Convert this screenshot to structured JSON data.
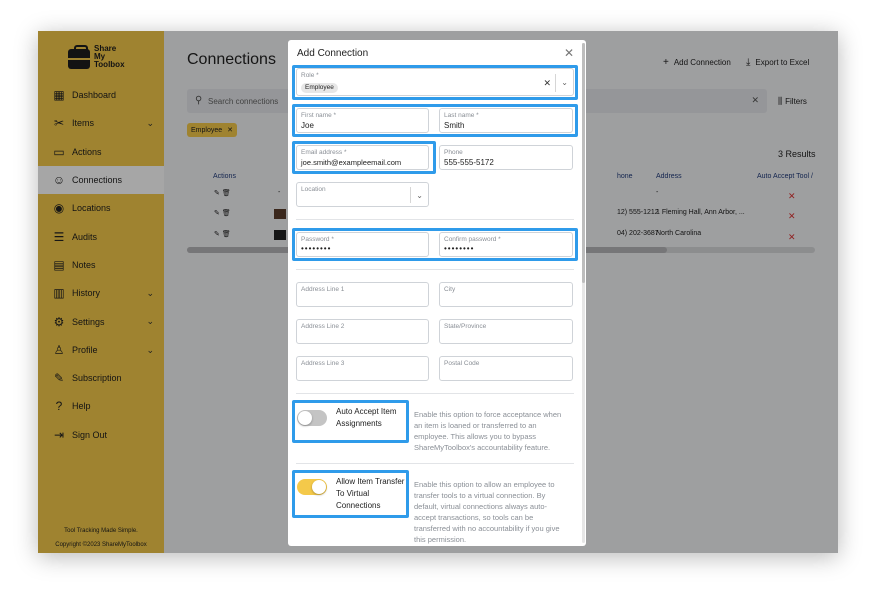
{
  "app": {
    "logo_line1": "Share",
    "logo_line2": "My",
    "logo_line3": "Toolbox",
    "tagline": "Tool Tracking Made Simple.",
    "copyright": "Copyright ©2023 ShareMyToolbox"
  },
  "colors": {
    "brand_yellow": "#f4c94a",
    "highlight_blue": "#2f9bea",
    "delete_red": "#dd3333",
    "header_blue": "#1f3a7a"
  },
  "sidebar": {
    "items": [
      {
        "label": "Dashboard",
        "icon": "dashboard-icon"
      },
      {
        "label": "Items",
        "icon": "items-icon",
        "chevron": "⌄"
      },
      {
        "label": "Actions",
        "icon": "actions-icon"
      },
      {
        "label": "Connections",
        "icon": "connections-icon",
        "active": true
      },
      {
        "label": "Locations",
        "icon": "location-pin-icon"
      },
      {
        "label": "Audits",
        "icon": "audits-icon"
      },
      {
        "label": "Notes",
        "icon": "notes-icon"
      },
      {
        "label": "History",
        "icon": "history-icon",
        "chevron": "⌄"
      },
      {
        "label": "Settings",
        "icon": "gear-icon",
        "chevron": "⌄"
      },
      {
        "label": "Profile",
        "icon": "profile-icon",
        "chevron": "⌄"
      },
      {
        "label": "Subscription",
        "icon": "subscription-icon"
      },
      {
        "label": "Help",
        "icon": "help-icon"
      },
      {
        "label": "Sign Out",
        "icon": "sign-out-icon"
      }
    ]
  },
  "main": {
    "title": "Connections",
    "add_connection": "Add Connection",
    "export": "Export to Excel",
    "search_placeholder": "Search connections",
    "filters": "Filters",
    "chip": "Employee",
    "results": "3 Results",
    "table": {
      "headers": {
        "actions": "Actions",
        "phone": "hone",
        "address": "Address",
        "auto_accept": "Auto Accept Tool /"
      },
      "rows": [
        {
          "phone": "",
          "address": "-",
          "dash": "-"
        },
        {
          "phone": "12) 555-1212",
          "address": "1 Fleming Hall, Ann Arbor, ..."
        },
        {
          "phone": "04) 202-3687",
          "address": "North Carolina"
        }
      ]
    }
  },
  "modal": {
    "title": "Add Connection",
    "role": {
      "label": "Role *",
      "value": "Employee"
    },
    "first_name": {
      "label": "First name *",
      "value": "Joe"
    },
    "last_name": {
      "label": "Last name *",
      "value": "Smith"
    },
    "email": {
      "label": "Email address *",
      "value": "joe.smith@exampleemail.com"
    },
    "phone": {
      "label": "Phone",
      "value": "555-555-5172"
    },
    "location": {
      "label": "Location"
    },
    "password": {
      "label": "Password *",
      "value": "••••••••"
    },
    "confirm_password": {
      "label": "Confirm password *",
      "value": "••••••••"
    },
    "address1": {
      "label": "Address Line 1"
    },
    "city": {
      "label": "City"
    },
    "address2": {
      "label": "Address Line 2"
    },
    "state": {
      "label": "State/Province"
    },
    "address3": {
      "label": "Address Line 3"
    },
    "postal": {
      "label": "Postal Code"
    },
    "auto_accept": {
      "label_line1": "Auto Accept Item",
      "label_line2": "Assignments",
      "on": false,
      "desc": [
        "Enable this option to force acceptance when",
        "an item is loaned or transferred to an",
        "employee. This allows you to bypass",
        "ShareMyToolbox's accountability feature."
      ]
    },
    "allow_transfer": {
      "label_line1": "Allow Item Transfer",
      "label_line2": "To Virtual",
      "label_line3": "Connections",
      "on": true,
      "desc": [
        "Enable this option to allow an employee to",
        "transfer tools to a virtual connection. By",
        "default, virtual connections always auto-",
        "accept transactions, so tools can be",
        "transferred with no accountability if you give",
        "this permission."
      ]
    }
  }
}
